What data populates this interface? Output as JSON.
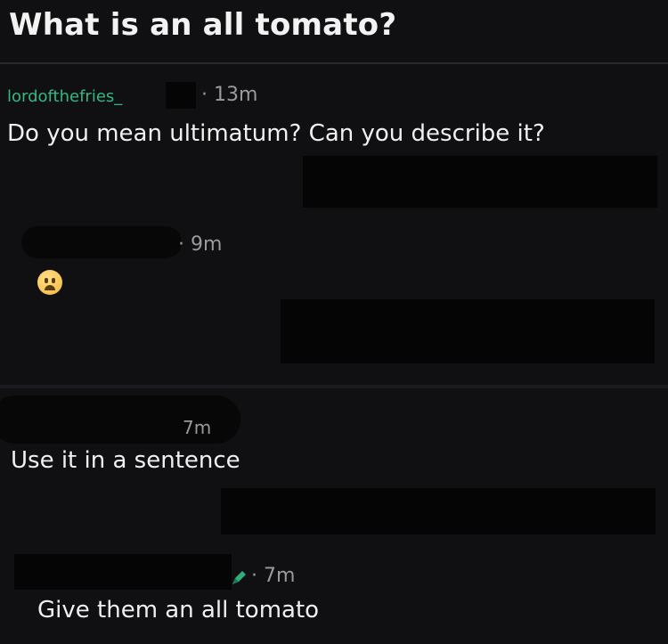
{
  "question": {
    "title": "What is an all tomato?"
  },
  "comments": [
    {
      "username": "lordofthefries_",
      "time": "· 13m",
      "text": "Do you mean ultimatum? Can you describe it?"
    },
    {
      "time": "· 9m",
      "emoji": "weary-face-emoji"
    },
    {
      "time": "7m",
      "text": "Use it in a sentence"
    },
    {
      "time": "· 7m",
      "text": "Give them an all tomato",
      "icon": "pencil-icon"
    }
  ]
}
